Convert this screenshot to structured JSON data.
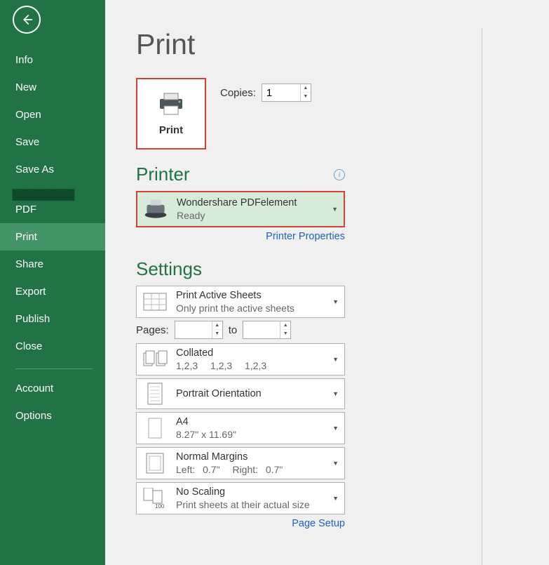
{
  "sidebar": {
    "items": [
      {
        "label": "Info"
      },
      {
        "label": "New"
      },
      {
        "label": "Open"
      },
      {
        "label": "Save"
      },
      {
        "label": "Save As"
      },
      {
        "label": "PDF",
        "obscured": true
      },
      {
        "label": "Print",
        "active": true
      },
      {
        "label": "Share"
      },
      {
        "label": "Export"
      },
      {
        "label": "Publish"
      },
      {
        "label": "Close"
      }
    ],
    "footer": [
      {
        "label": "Account"
      },
      {
        "label": "Options"
      }
    ]
  },
  "page": {
    "title": "Print",
    "print_button": "Print",
    "copies_label": "Copies:",
    "copies_value": "1"
  },
  "printer_section": {
    "heading": "Printer",
    "selected": {
      "name": "Wondershare PDFelement",
      "status": "Ready"
    },
    "properties_link": "Printer Properties"
  },
  "settings_section": {
    "heading": "Settings",
    "print_what": {
      "title": "Print Active Sheets",
      "sub": "Only print the active sheets"
    },
    "pages_label": "Pages:",
    "pages_to": "to",
    "pages_from": "",
    "pages_to_val": "",
    "collation": {
      "title": "Collated",
      "sub": "1,2,3  1,2,3  1,2,3"
    },
    "orientation": {
      "title": "Portrait Orientation",
      "sub": ""
    },
    "paper": {
      "title": "A4",
      "sub": "8.27\" x 11.69\""
    },
    "margins": {
      "title": "Normal Margins",
      "sub": "Left:  0.7\"  Right:  0.7\""
    },
    "scaling": {
      "title": "No Scaling",
      "sub": "Print sheets at their actual size"
    },
    "page_setup_link": "Page Setup"
  }
}
